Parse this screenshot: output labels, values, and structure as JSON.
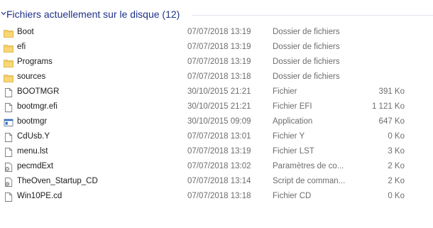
{
  "group": {
    "title": "Fichiers actuellement sur le disque (12)"
  },
  "files": [
    {
      "name": "Boot",
      "date": "07/07/2018 13:19",
      "type": "Dossier de fichiers",
      "size": "",
      "icon": "folder-icon"
    },
    {
      "name": "efi",
      "date": "07/07/2018 13:19",
      "type": "Dossier de fichiers",
      "size": "",
      "icon": "folder-icon"
    },
    {
      "name": "Programs",
      "date": "07/07/2018 13:19",
      "type": "Dossier de fichiers",
      "size": "",
      "icon": "folder-icon"
    },
    {
      "name": "sources",
      "date": "07/07/2018 13:18",
      "type": "Dossier de fichiers",
      "size": "",
      "icon": "folder-icon"
    },
    {
      "name": "BOOTMGR",
      "date": "30/10/2015 21:21",
      "type": "Fichier",
      "size": "391 Ko",
      "icon": "file-icon"
    },
    {
      "name": "bootmgr.efi",
      "date": "30/10/2015 21:21",
      "type": "Fichier EFI",
      "size": "1 121 Ko",
      "icon": "file-icon"
    },
    {
      "name": "bootmgr",
      "date": "30/10/2015 09:09",
      "type": "Application",
      "size": "647 Ko",
      "icon": "application-icon"
    },
    {
      "name": "CdUsb.Y",
      "date": "07/07/2018 13:01",
      "type": "Fichier Y",
      "size": "0 Ko",
      "icon": "file-icon"
    },
    {
      "name": "menu.lst",
      "date": "07/07/2018 13:19",
      "type": "Fichier LST",
      "size": "3 Ko",
      "icon": "file-icon"
    },
    {
      "name": "pecmdExt",
      "date": "07/07/2018 13:02",
      "type": "Paramètres de co...",
      "size": "2 Ko",
      "icon": "settings-file-icon"
    },
    {
      "name": "TheOven_Startup_CD",
      "date": "07/07/2018 13:14",
      "type": "Script de comman...",
      "size": "2 Ko",
      "icon": "script-file-icon"
    },
    {
      "name": "Win10PE.cd",
      "date": "07/07/2018 13:18",
      "type": "Fichier CD",
      "size": "0 Ko",
      "icon": "file-icon"
    }
  ],
  "colors": {
    "group_title": "#1e3287",
    "folder": "#f6d26a",
    "secondary_text": "#6d6d6d"
  }
}
